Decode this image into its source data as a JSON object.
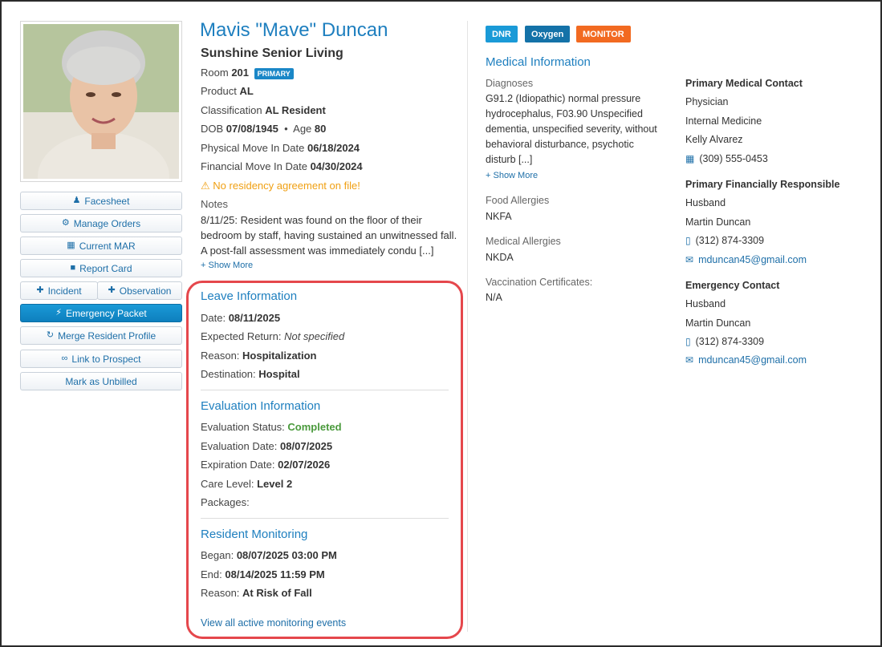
{
  "resident": {
    "name": "Mavis \"Mave\" Duncan",
    "facility": "Sunshine Senior Living",
    "room_label": "Room",
    "room": "201",
    "room_badge": "PRIMARY",
    "product_label": "Product",
    "product": "AL",
    "classification_label": "Classification",
    "classification": "AL Resident",
    "dob_label": "DOB",
    "dob": "07/08/1945",
    "age_label": "Age",
    "age": "80",
    "physical_move_label": "Physical Move In Date",
    "physical_move": "06/18/2024",
    "financial_move_label": "Financial Move In Date",
    "financial_move": "04/30/2024",
    "warning": "No residency agreement on file!",
    "notes_label": "Notes",
    "notes": "8/11/25: Resident was found on the floor of their bedroom by staff, having sustained an unwitnessed fall. A post-fall assessment was immediately condu [...]",
    "show_more": "Show More"
  },
  "actions": {
    "facesheet": "Facesheet",
    "manage_orders": "Manage Orders",
    "current_mar": "Current MAR",
    "report_card": "Report Card",
    "incident": "Incident",
    "observation": "Observation",
    "emergency_packet": "Emergency Packet",
    "merge_profile": "Merge Resident Profile",
    "link_prospect": "Link to Prospect",
    "mark_unbilled": "Mark as Unbilled"
  },
  "leave": {
    "title": "Leave Information",
    "date_label": "Date:",
    "date": "08/11/2025",
    "return_label": "Expected Return:",
    "return": "Not specified",
    "reason_label": "Reason:",
    "reason": "Hospitalization",
    "destination_label": "Destination:",
    "destination": "Hospital"
  },
  "evaluation": {
    "title": "Evaluation Information",
    "status_label": "Evaluation Status:",
    "status": "Completed",
    "date_label": "Evaluation Date:",
    "date": "08/07/2025",
    "expiration_label": "Expiration Date:",
    "expiration": "02/07/2026",
    "care_label": "Care Level:",
    "care": "Level 2",
    "packages_label": "Packages:"
  },
  "monitoring": {
    "title": "Resident Monitoring",
    "began_label": "Began:",
    "began": "08/07/2025 03:00 PM",
    "end_label": "End:",
    "end": "08/14/2025 11:59 PM",
    "reason_label": "Reason:",
    "reason": "At Risk of Fall",
    "view_all": "View all active monitoring events"
  },
  "tags": {
    "dnr": "DNR",
    "oxygen": "Oxygen",
    "monitor": "MONITOR",
    "colors": {
      "dnr": "#1a9ad7",
      "oxygen": "#1472a8",
      "monitor": "#f26a21"
    }
  },
  "medical": {
    "title": "Medical Information",
    "diagnoses_label": "Diagnoses",
    "diagnoses": "G91.2 (Idiopathic) normal pressure hydrocephalus, F03.90 Unspecified dementia, unspecified severity, without behavioral disturbance, psychotic disturb [...]",
    "show_more": "Show More",
    "food_label": "Food Allergies",
    "food": "NKFA",
    "med_label": "Medical Allergies",
    "med": "NKDA",
    "vacc_label": "Vaccination Certificates:",
    "vacc": "N/A"
  },
  "contacts": {
    "medical": {
      "title": "Primary Medical Contact",
      "role": "Physician",
      "specialty": "Internal Medicine",
      "name": "Kelly Alvarez",
      "phone": "(309) 555-0453"
    },
    "financial": {
      "title": "Primary Financially Responsible",
      "relation": "Husband",
      "name": "Martin Duncan",
      "phone": "(312) 874-3309",
      "email": "mduncan45@gmail.com"
    },
    "emergency": {
      "title": "Emergency Contact",
      "relation": "Husband",
      "name": "Martin Duncan",
      "phone": "(312) 874-3309",
      "email": "mduncan45@gmail.com"
    }
  }
}
